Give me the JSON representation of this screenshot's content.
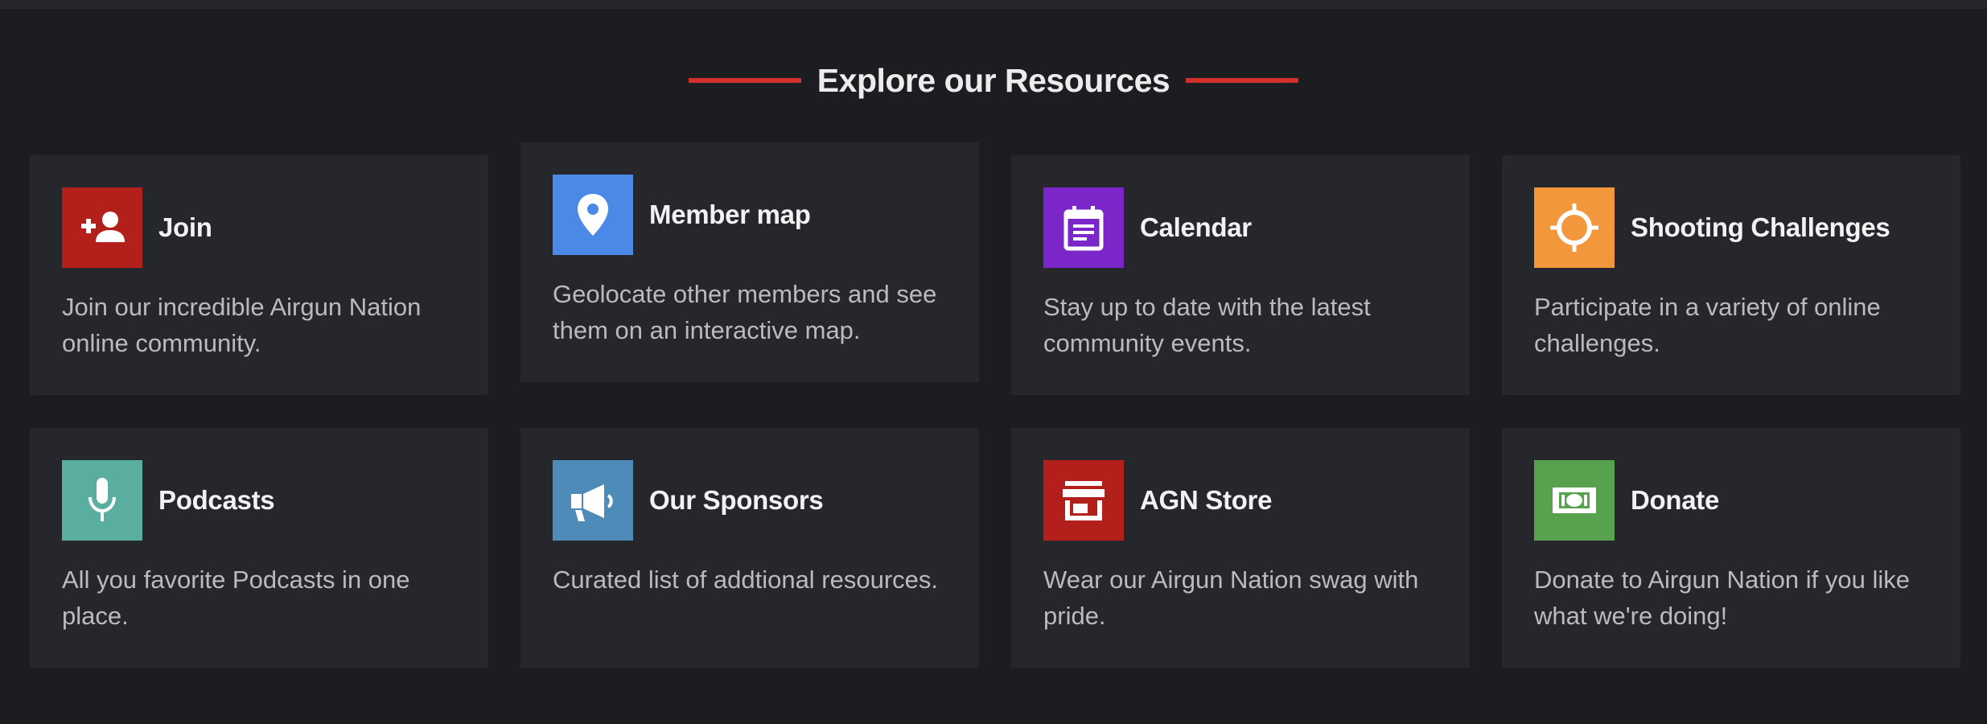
{
  "section": {
    "title": "Explore our Resources",
    "accent_color": "#d2302c"
  },
  "cards": [
    {
      "title": "Join",
      "description": "Join our incredible Airgun Nation online community.",
      "icon": "add-person-icon",
      "color": "#b3201b"
    },
    {
      "title": "Member map",
      "description": "Geolocate other members and see them on an interactive map.",
      "icon": "map-pin-icon",
      "color": "#4a89e6"
    },
    {
      "title": "Calendar",
      "description": "Stay up to date with the latest community events.",
      "icon": "calendar-icon",
      "color": "#7a26c8"
    },
    {
      "title": "Shooting Challenges",
      "description": "Participate in a variety of online challenges.",
      "icon": "crosshair-icon",
      "color": "#f2973b"
    },
    {
      "title": "Podcasts",
      "description": "All you favorite Podcasts in one place.",
      "icon": "microphone-icon",
      "color": "#5aaea0"
    },
    {
      "title": "Our Sponsors",
      "description": "Curated list of addtional resources.",
      "icon": "megaphone-icon",
      "color": "#4e8bb8"
    },
    {
      "title": "AGN Store",
      "description": "Wear our Airgun Nation swag with pride.",
      "icon": "storefront-icon",
      "color": "#b3201b"
    },
    {
      "title": "Donate",
      "description": "Donate to Airgun Nation if you like what we're doing!",
      "icon": "money-icon",
      "color": "#58a24f"
    }
  ]
}
